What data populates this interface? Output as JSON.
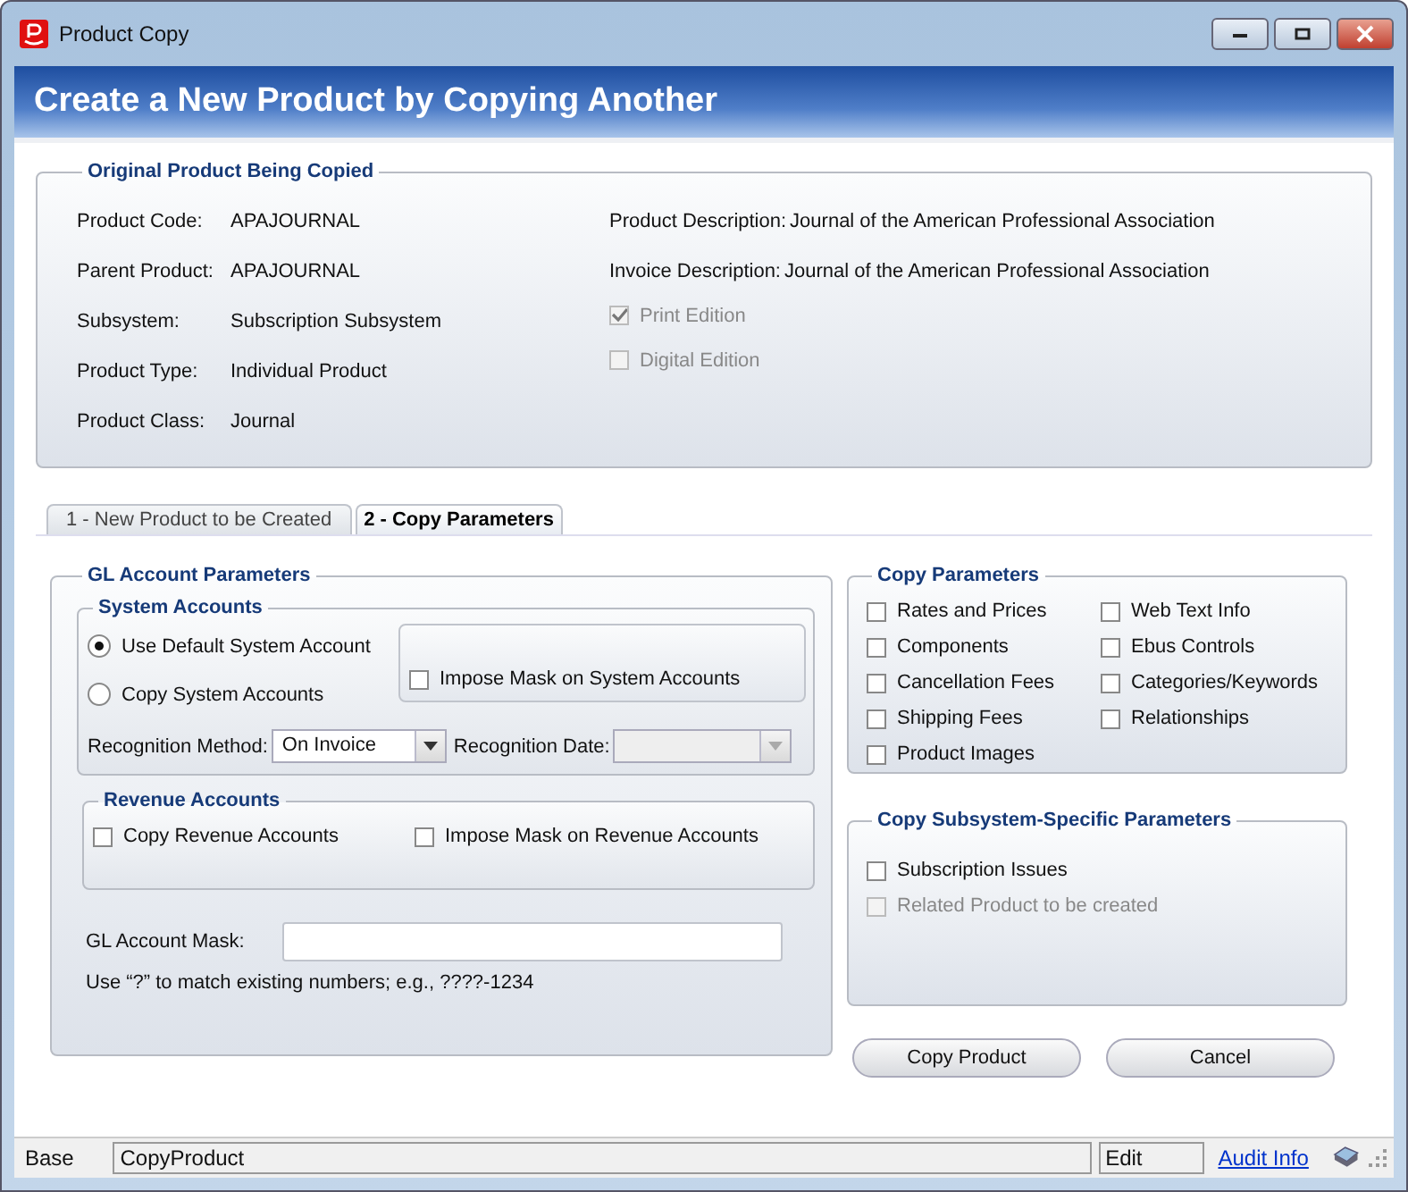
{
  "window": {
    "title": "Product Copy"
  },
  "header": {
    "title": "Create a New Product by Copying Another"
  },
  "original_product": {
    "title": "Original Product Being Copied",
    "fields": [
      {
        "label": "Product Code:",
        "value": "APAJOURNAL"
      },
      {
        "label": "Parent Product:",
        "value": "APAJOURNAL"
      },
      {
        "label": "Subsystem:",
        "value": "Subscription Subsystem"
      },
      {
        "label": "Product Type:",
        "value": "Individual Product"
      },
      {
        "label": "Product Class:",
        "value": "Journal"
      }
    ],
    "descriptions": [
      {
        "label": "Product Description:",
        "value": "Journal of the American Professional Association"
      },
      {
        "label": "Invoice Description:",
        "value": "Journal of the American Professional Association"
      }
    ],
    "editions": [
      {
        "label": "Print Edition",
        "checked": true,
        "disabled": true
      },
      {
        "label": "Digital Edition",
        "checked": false,
        "disabled": true
      }
    ]
  },
  "tabs": [
    {
      "label": "1 - New Product to be Created",
      "selected": false
    },
    {
      "label": "2 - Copy Parameters",
      "selected": true
    }
  ],
  "gl_account_parameters": {
    "title": "GL Account Parameters",
    "system_accounts": {
      "title": "System Accounts",
      "options": [
        {
          "label": "Use Default System Account",
          "selected": true
        },
        {
          "label": "Copy System Accounts",
          "selected": false
        }
      ],
      "impose_mask": {
        "label": "Impose Mask on System Accounts",
        "checked": false
      },
      "recognition_method": {
        "label": "Recognition Method:",
        "value": "On Invoice"
      },
      "recognition_date": {
        "label": "Recognition Date:",
        "disabled": true
      }
    },
    "revenue_accounts": {
      "title": "Revenue Accounts",
      "checkboxes": [
        {
          "label": "Copy Revenue Accounts",
          "checked": false
        },
        {
          "label": "Impose Mask on Revenue Accounts",
          "checked": false
        }
      ]
    },
    "mask": {
      "label": "GL Account Mask:"
    },
    "hint": "Use “?” to match existing numbers; e.g., ????-1234"
  },
  "copy_parameters": {
    "title": "Copy Parameters",
    "items": [
      {
        "label": "Rates and Prices",
        "checked": false
      },
      {
        "label": "Web Text Info",
        "checked": false
      },
      {
        "label": "Components",
        "checked": false
      },
      {
        "label": "Ebus Controls",
        "checked": false
      },
      {
        "label": "Cancellation Fees",
        "checked": false
      },
      {
        "label": "Categories/Keywords",
        "checked": false
      },
      {
        "label": "Shipping Fees",
        "checked": false
      },
      {
        "label": "Relationships",
        "checked": false
      },
      {
        "label": "Product Images",
        "checked": false
      }
    ]
  },
  "subsystem_parameters": {
    "title": "Copy Subsystem-Specific Parameters",
    "items": [
      {
        "label": "Subscription Issues",
        "checked": false,
        "disabled": false
      },
      {
        "label": "Related Product to be created",
        "checked": false,
        "disabled": true
      }
    ]
  },
  "buttons": [
    "Copy Product",
    "Cancel"
  ],
  "status_bar": {
    "mode": "Base",
    "form": "CopyProduct",
    "state": "Edit",
    "link": "Audit Info"
  }
}
